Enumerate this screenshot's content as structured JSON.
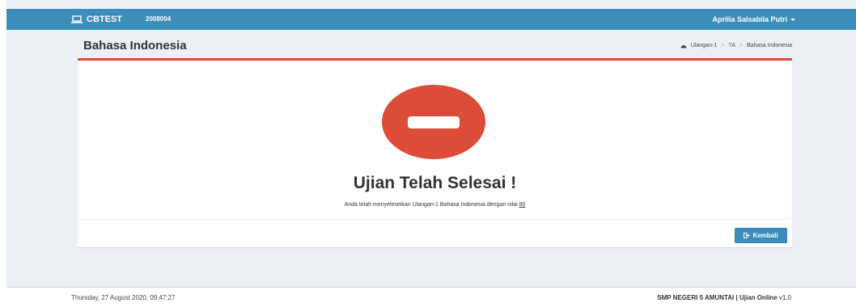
{
  "navbar": {
    "brand_prefix": "CB",
    "brand_suffix": "TEST",
    "exam_code": "2008004",
    "user_name": "Aprilia Salsabila Putri",
    "colors": {
      "navbar": "#3c8dbc"
    }
  },
  "header": {
    "title": "Bahasa Indonesia",
    "breadcrumb": [
      "Ulangan-1",
      "7A",
      "Bahasa Indonesia"
    ]
  },
  "result": {
    "icon": "stop-icon",
    "title": "Ujian Telah Selesai !",
    "message_prefix": "Anda telah menyeleseikan Ulangan-1 Bahasa Indonesia dengan nilai",
    "score": "80",
    "colors": {
      "accent": "#dd4b39"
    }
  },
  "actions": {
    "back_label": "Kembali"
  },
  "footer": {
    "datetime": "Thursday, 27 August 2020, 09:47:27",
    "school": "SMP NEGERI 5 AMUNTAI",
    "separator": "|",
    "app_name": "Ujian Online",
    "version": "v1.0"
  }
}
